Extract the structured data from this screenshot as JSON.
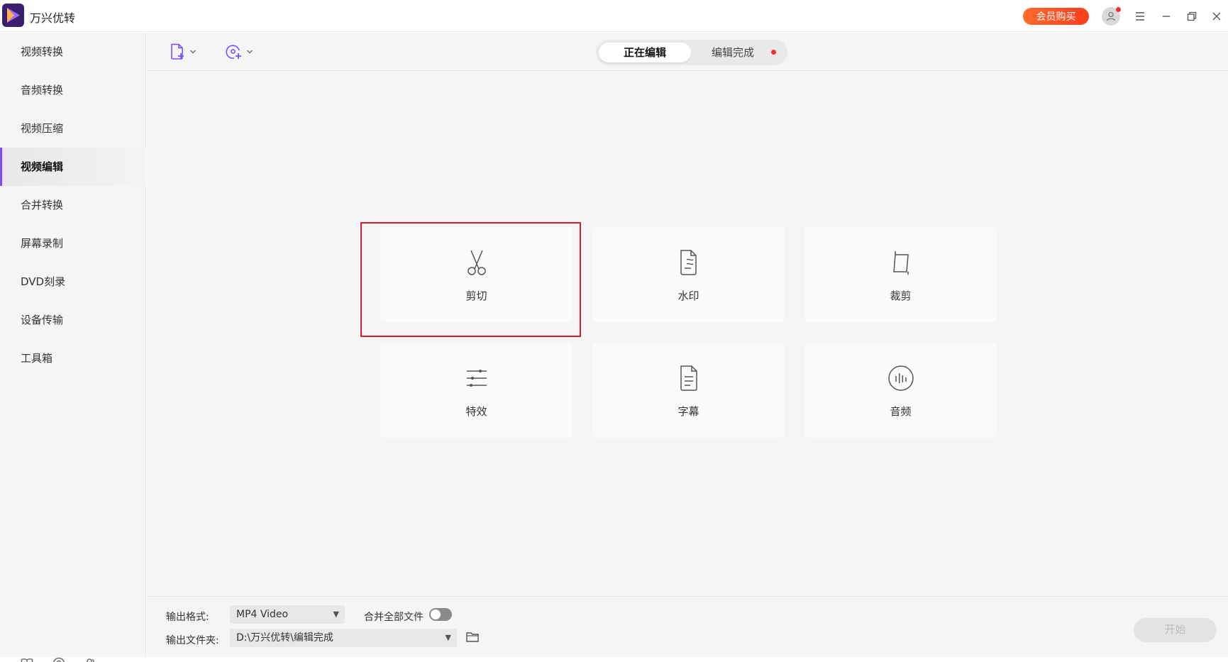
{
  "app": {
    "title": "万兴优转"
  },
  "titlebar": {
    "vip_label": "会员购买"
  },
  "sidebar": {
    "items": [
      {
        "label": "视频转换"
      },
      {
        "label": "音频转换"
      },
      {
        "label": "视频压缩"
      },
      {
        "label": "视频编辑",
        "active": true
      },
      {
        "label": "合并转换"
      },
      {
        "label": "屏幕录制"
      },
      {
        "label": "DVD刻录"
      },
      {
        "label": "设备传输"
      },
      {
        "label": "工具箱"
      }
    ]
  },
  "tabs": {
    "editing": "正在编辑",
    "done": "编辑完成"
  },
  "tiles": [
    {
      "label": "剪切",
      "icon": "scissors-icon"
    },
    {
      "label": "水印",
      "icon": "watermark-icon"
    },
    {
      "label": "裁剪",
      "icon": "crop-icon"
    },
    {
      "label": "特效",
      "icon": "sliders-icon"
    },
    {
      "label": "字幕",
      "icon": "subtitle-icon"
    },
    {
      "label": "音频",
      "icon": "audio-icon"
    }
  ],
  "bottom": {
    "format_label": "输出格式:",
    "format_value": "MP4 Video",
    "merge_label": "合并全部文件",
    "merge_enabled": false,
    "folder_label": "输出文件夹:",
    "folder_value": "D:\\万兴优转\\编辑完成",
    "start_label": "开始"
  },
  "colors": {
    "accent": "#7b4dff",
    "vip": "#ff4d24",
    "highlight": "#d9202a"
  }
}
